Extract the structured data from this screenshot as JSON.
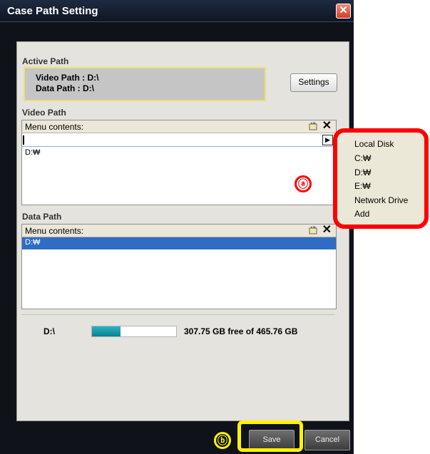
{
  "window": {
    "title": "Case Path Setting",
    "close_glyph": "✕"
  },
  "active_path": {
    "label": "Active Path",
    "video_line": "Video Path : D:\\",
    "data_line": "Data Path : D:\\",
    "settings_button": "Settings"
  },
  "video_path": {
    "label": "Video Path",
    "header": "Menu contents:",
    "items": [
      "D:₩"
    ]
  },
  "data_path": {
    "label": "Data Path",
    "header": "Menu contents:",
    "items": [
      "D:₩"
    ]
  },
  "disk": {
    "name": "D:\\",
    "info": "307.75 GB free of 465.76 GB",
    "used_fraction": 0.34
  },
  "buttons": {
    "save": "Save",
    "cancel": "Cancel"
  },
  "popup_menu": {
    "items": [
      "Local Disk",
      "C:₩",
      "D:₩",
      "E:₩",
      "Network Drive",
      "Add"
    ]
  },
  "annotations": {
    "a": "ⓐ",
    "b": "ⓑ"
  },
  "colors": {
    "highlight_red": "#ff0000",
    "highlight_yellow": "#fff200",
    "selection": "#2f6cc4"
  }
}
